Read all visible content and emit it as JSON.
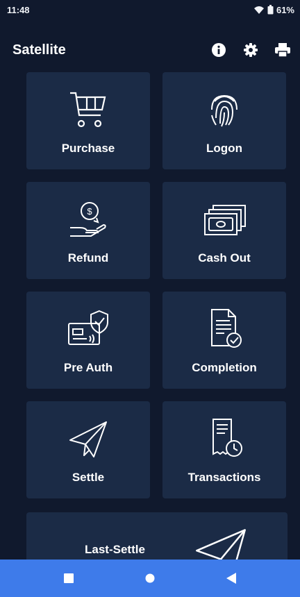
{
  "status_bar": {
    "time": "11:48",
    "battery": "61%",
    "icons": [
      "wifi-icon",
      "battery-icon"
    ]
  },
  "app_bar": {
    "title": "Satellite",
    "actions": [
      "info-icon",
      "settings-icon",
      "print-icon"
    ]
  },
  "tiles": [
    {
      "label": "Purchase",
      "icon": "cart-icon"
    },
    {
      "label": "Logon",
      "icon": "fingerprint-icon"
    },
    {
      "label": "Refund",
      "icon": "refund-icon"
    },
    {
      "label": "Cash Out",
      "icon": "cash-icon"
    },
    {
      "label": "Pre Auth",
      "icon": "card-shield-icon"
    },
    {
      "label": "Completion",
      "icon": "document-check-icon"
    },
    {
      "label": "Settle",
      "icon": "paper-plane-icon"
    },
    {
      "label": "Transactions",
      "icon": "receipt-clock-icon"
    },
    {
      "label": "Last-Settle",
      "icon": "paper-plane-icon"
    }
  ],
  "nav_bar": {
    "buttons": [
      "recents-icon",
      "home-icon",
      "back-icon"
    ]
  },
  "colors": {
    "background": "#10192d",
    "tile": "#1b2b46",
    "nav": "#3e7bea"
  }
}
